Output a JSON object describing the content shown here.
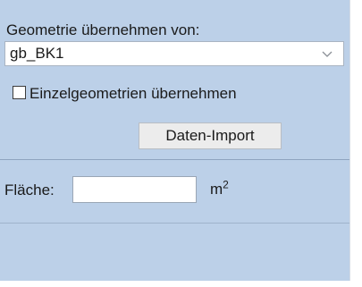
{
  "geometry_source": {
    "label": "Geometrie übernehmen von:",
    "selected": "gb_BK1"
  },
  "single_geometries": {
    "label": "Einzelgeometrien übernehmen",
    "checked": false
  },
  "import_button": {
    "label": "Daten-Import"
  },
  "area": {
    "label": "Fläche:",
    "value": "",
    "unit_base": "m",
    "unit_exponent": "2"
  },
  "icons": {
    "dropdown": "chevron-down-icon"
  },
  "colors": {
    "panel_background": "#bcd0e8"
  }
}
